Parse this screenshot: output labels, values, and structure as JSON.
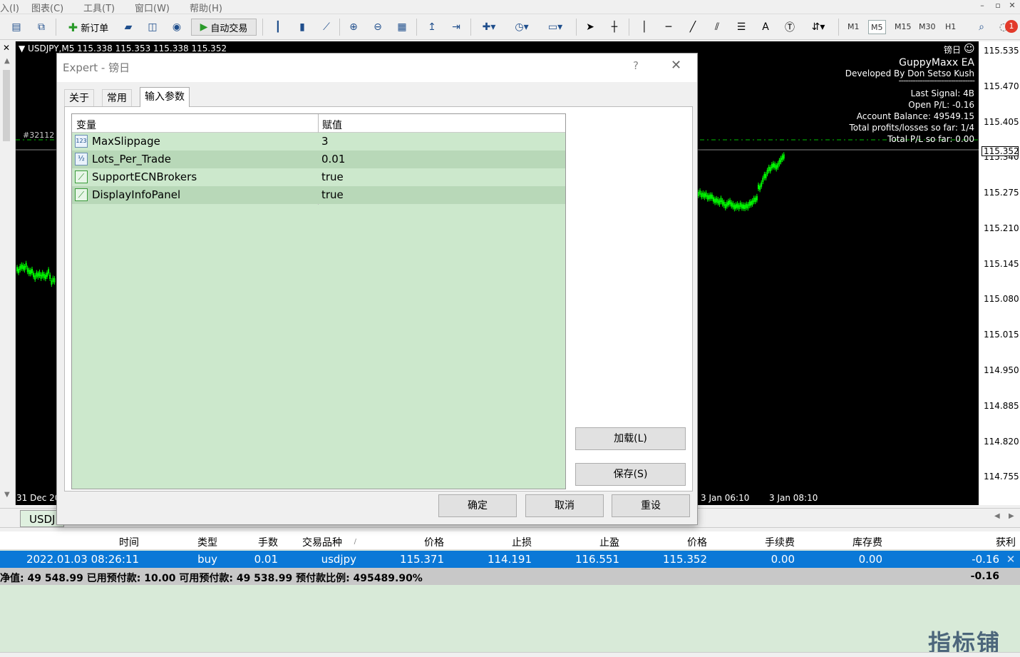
{
  "menu": {
    "items": [
      "入(I)",
      "图表(C)",
      "工具(T)",
      "窗口(W)",
      "帮助(H)"
    ],
    "win_minimize": "–",
    "win_restore": "▫",
    "win_close": "✕"
  },
  "toolbar": {
    "new_order": "新订单",
    "auto_trade": "自动交易",
    "timeframes": [
      "M1",
      "M5",
      "M15",
      "M30",
      "H1"
    ],
    "active_timeframe": "M5",
    "notification_count": "1"
  },
  "chart": {
    "header": "USDJPY,M5  115.338 115.353 115.338 115.352",
    "order_label": "#32112",
    "ea_name_label": "镑日",
    "info": {
      "title": "GuppyMaxx EA",
      "developer": "Developed By Don Setso Kush",
      "divider": "--------------------------------",
      "last_signal": "Last Signal: 4B",
      "open_pl": "Open P/L: -0.16",
      "account_balance": "Account Balance: 49549.15",
      "total_pl_count": "Total profits/losses so far: 1/4",
      "total_pl": "Total P/L so far: 0.00"
    },
    "price_ticks": [
      "115.535",
      "115.470",
      "115.405",
      "115.340",
      "115.275",
      "115.210",
      "115.145",
      "115.080",
      "115.015",
      "114.950",
      "114.885",
      "114.820",
      "114.755"
    ],
    "current_price": "115.352",
    "time_ticks": [
      "31 Dec 20",
      "3 Jan 06:10",
      "3 Jan 08:10"
    ],
    "tab_label": "USDJ"
  },
  "dialog": {
    "title": "Expert - 镑日",
    "help": "?",
    "close": "✕",
    "tabs": [
      "关于",
      "常用",
      "输入参数"
    ],
    "active_tab": "输入参数",
    "columns": [
      "变量",
      "赋值"
    ],
    "params": [
      {
        "icon": "123",
        "name": "MaxSlippage",
        "value": "3"
      },
      {
        "icon": "½",
        "name": "Lots_Per_Trade",
        "value": "0.01"
      },
      {
        "icon": "bool",
        "name": "SupportECNBrokers",
        "value": "true"
      },
      {
        "icon": "bool",
        "name": "DisplayInfoPanel",
        "value": "true"
      }
    ],
    "load_button": "加载(L)",
    "save_button": "保存(S)",
    "ok_button": "确定",
    "cancel_button": "取消",
    "reset_button": "重设"
  },
  "trades": {
    "headers": [
      "时间",
      "类型",
      "手数",
      "交易品种",
      "价格",
      "止损",
      "止盈",
      "价格",
      "手续费",
      "库存费",
      "获利"
    ],
    "sort_marker": "/",
    "row": [
      "2022.01.03 08:26:11",
      "buy",
      "0.01",
      "usdjpy",
      "115.371",
      "114.191",
      "116.551",
      "115.352",
      "0.00",
      "0.00",
      "-0.16"
    ],
    "close_icon": "✕",
    "summary": "净值: 49 548.99  已用预付款: 10.00  可用预付款: 49 538.99  预付款比例: 495489.90%",
    "summary_profit": "-0.16"
  },
  "watermark": "指标铺",
  "colors": {
    "chart_bg": "#000000",
    "candle": "#00ff00",
    "selected_row": "#0a78d7",
    "panel_green": "#cce8cc"
  }
}
